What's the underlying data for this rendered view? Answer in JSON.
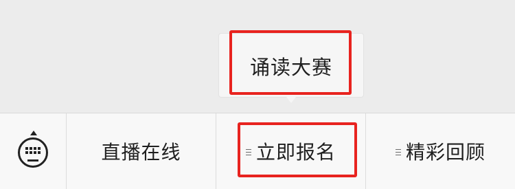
{
  "popup": {
    "items": [
      {
        "label": "诵读大赛"
      }
    ]
  },
  "menubar": {
    "items": [
      {
        "label": "直播在线",
        "has_submenu": false
      },
      {
        "label": "立即报名",
        "has_submenu": true
      },
      {
        "label": "精彩回顾",
        "has_submenu": true
      }
    ],
    "left_icon": "keyboard-icon"
  },
  "colors": {
    "background": "#ececec",
    "menubar": "#f8f8f8",
    "highlight": "#e8231f",
    "text": "#1f1f1f"
  }
}
